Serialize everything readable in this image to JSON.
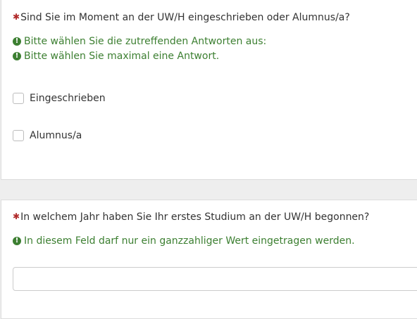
{
  "question1": {
    "required_mark": "✱",
    "text": "Sind Sie im Moment an der UW/H eingeschrieben oder Alumnus/a?",
    "tips": [
      "Bitte wählen Sie die zutreffenden Antworten aus:",
      "Bitte wählen Sie maximal eine Antwort."
    ],
    "options": [
      {
        "label": "Eingeschrieben",
        "checked": false
      },
      {
        "label": "Alumnus/a",
        "checked": false
      }
    ]
  },
  "question2": {
    "required_mark": "✱",
    "text": "In welchem Jahr haben Sie Ihr erstes Studium an der UW/H begonnen?",
    "tips": [
      "In diesem Feld darf nur ein ganzzahliger Wert eingetragen werden."
    ],
    "input_value": ""
  },
  "icons": {
    "tip_icon": "exclamation-circle-icon",
    "required_icon": "asterisk-icon"
  },
  "colors": {
    "required": "#b02a2a",
    "tip": "#3c7f31"
  }
}
